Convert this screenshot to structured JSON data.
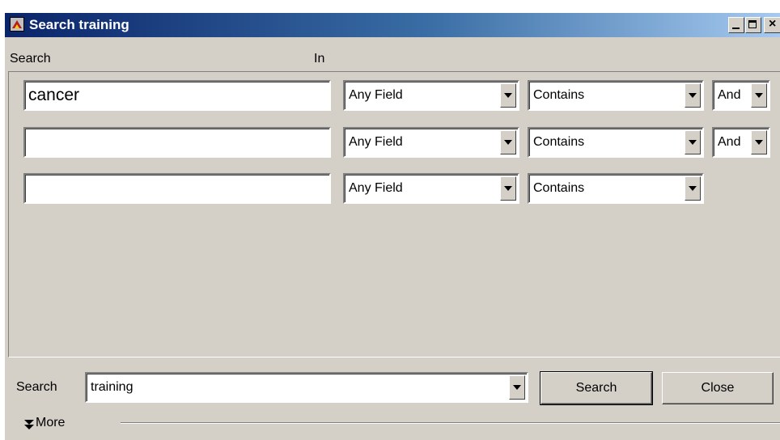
{
  "window": {
    "title": "Search training",
    "controls": {
      "minimize": "_",
      "maximize": "□",
      "close": "×"
    }
  },
  "header": {
    "search_label": "Search",
    "in_label": "In"
  },
  "criteria": [
    {
      "term": "cancer",
      "field": "Any Field",
      "operator": "Contains",
      "connector": "And"
    },
    {
      "term": "",
      "field": "Any Field",
      "operator": "Contains",
      "connector": "And"
    },
    {
      "term": "",
      "field": "Any Field",
      "operator": "Contains"
    }
  ],
  "footer": {
    "search_label": "Search",
    "scope_value": "training",
    "search_button": "Search",
    "close_button": "Close",
    "more_label": "More"
  },
  "icons": {
    "app": "app-logo-icon",
    "more": "double-chevron-down-icon",
    "dropdown": "dropdown-arrow-icon"
  },
  "colors": {
    "titlebar_start": "#0a246a",
    "titlebar_end": "#a6caf0",
    "face": "#d4d0c8"
  }
}
